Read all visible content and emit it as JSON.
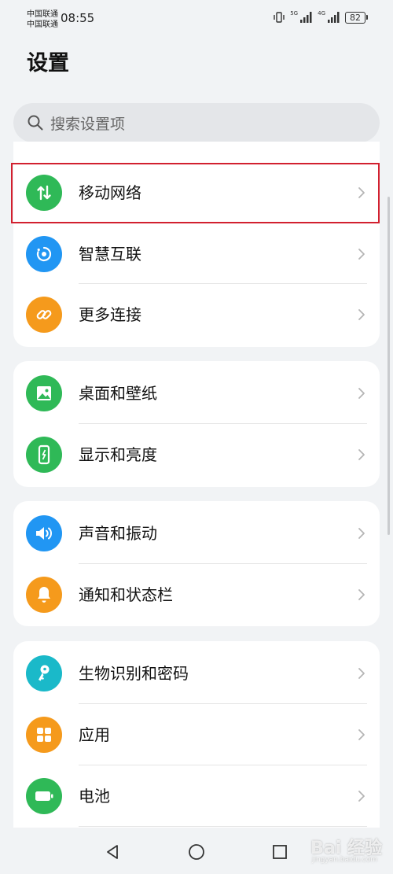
{
  "status_bar": {
    "carrier_1": "中国联通",
    "carrier_2": "中国联通",
    "time": "08:55",
    "network_1": "5G",
    "network_2": "4G",
    "battery": "82"
  },
  "title": "设置",
  "search": {
    "placeholder": "搜索设置项"
  },
  "groups": [
    {
      "items": [
        {
          "label": "移动网络",
          "icon": "mobile-data-icon",
          "color": "#2fb957"
        },
        {
          "label": "智慧互联",
          "icon": "smart-connect-icon",
          "color": "#2196f3"
        },
        {
          "label": "更多连接",
          "icon": "link-icon",
          "color": "#f59a1c"
        }
      ]
    },
    {
      "items": [
        {
          "label": "桌面和壁纸",
          "icon": "wallpaper-icon",
          "color": "#2fb957"
        },
        {
          "label": "显示和亮度",
          "icon": "display-icon",
          "color": "#2fb957"
        }
      ]
    },
    {
      "items": [
        {
          "label": "声音和振动",
          "icon": "sound-icon",
          "color": "#2196f3"
        },
        {
          "label": "通知和状态栏",
          "icon": "bell-icon",
          "color": "#f59a1c"
        }
      ]
    },
    {
      "items": [
        {
          "label": "生物识别和密码",
          "icon": "key-icon",
          "color": "#1ab9c9"
        },
        {
          "label": "应用",
          "icon": "apps-icon",
          "color": "#f59a1c"
        },
        {
          "label": "电池",
          "icon": "battery-icon",
          "color": "#2fb957"
        }
      ]
    }
  ],
  "watermark": {
    "text": "Bai 经验",
    "sub": "jingyan.baidu.com"
  }
}
